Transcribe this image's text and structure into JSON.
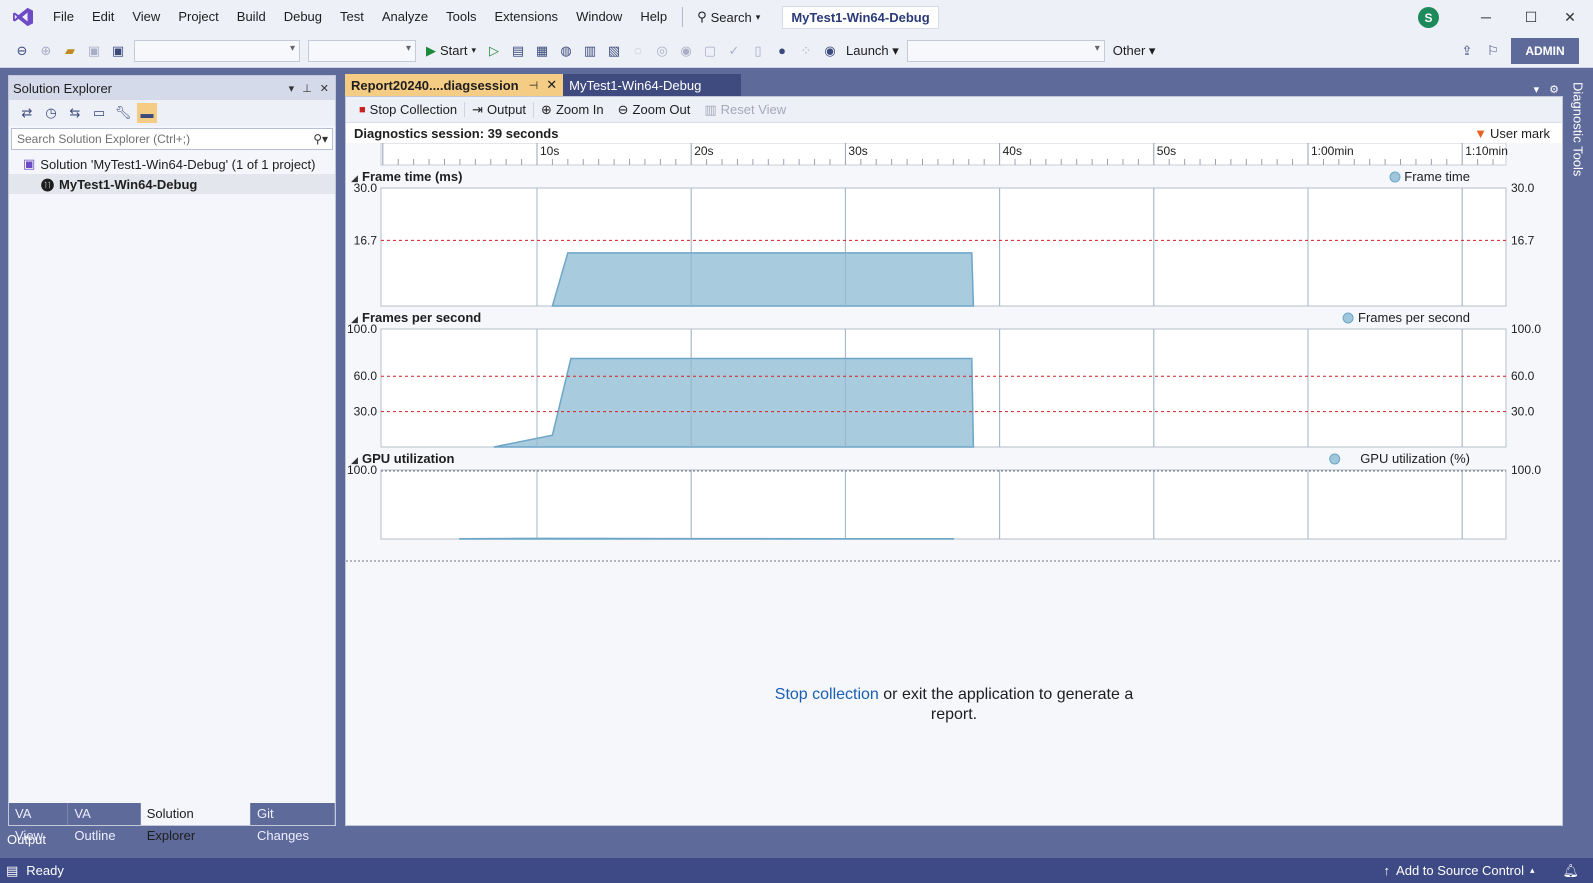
{
  "menu": {
    "items": [
      "File",
      "Edit",
      "View",
      "Project",
      "Build",
      "Debug",
      "Test",
      "Analyze",
      "Tools",
      "Extensions",
      "Window",
      "Help"
    ],
    "search_label": "Search",
    "project_title": "MyTest1-Win64-Debug",
    "avatar_letter": "S"
  },
  "toolbar": {
    "start_label": "Start",
    "launch_label": "Launch",
    "other_label": "Other",
    "admin_label": "ADMIN"
  },
  "solution_explorer": {
    "title": "Solution Explorer",
    "search_placeholder": "Search Solution Explorer (Ctrl+;)",
    "solution_label": "Solution 'MyTest1-Win64-Debug' (1 of 1 project)",
    "project_label": "MyTest1-Win64-Debug",
    "tabs": [
      "VA View",
      "VA Outline",
      "Solution Explorer",
      "Git Changes"
    ]
  },
  "doc_tabs": {
    "active": "Report20240....diagsession",
    "inactive": "MyTest1-Win64-Debug"
  },
  "diagnostics": {
    "toolbar": {
      "stop": "Stop Collection",
      "output": "Output",
      "zoom_in": "Zoom In",
      "zoom_out": "Zoom Out",
      "reset_view": "Reset View"
    },
    "session_text": "Diagnostics session: 39 seconds",
    "user_mark": "User mark",
    "report_link": "Stop collection",
    "report_text": " or exit the application to generate a report."
  },
  "side_tab": "Diagnostic Tools",
  "output_tab": "Output",
  "status": {
    "ready": "Ready",
    "source_control": "Add to Source Control"
  },
  "colors": {
    "accent": "#5e6a9a",
    "fill": "#9fc6da",
    "stroke": "#6ea6c8",
    "threshold": "#d02020",
    "tab_active": "#f5cc84"
  },
  "chart_data": [
    {
      "type": "area",
      "title": "Frame time (ms)",
      "legend": "Frame time",
      "ylim": [
        0,
        30
      ],
      "yticks": [
        30.0,
        16.7
      ],
      "ytick_labels": [
        "30.0",
        "16.7"
      ],
      "threshold": 16.7,
      "x": [
        11,
        12,
        20,
        30,
        38.2,
        38.3
      ],
      "values": [
        0,
        13.5,
        13.5,
        13.5,
        13.5,
        0
      ],
      "xaxis_ticks": [
        "10s",
        "20s",
        "30s",
        "40s",
        "50s",
        "1:00min",
        "1:10min"
      ]
    },
    {
      "type": "area",
      "title": "Frames per second",
      "legend": "Frames per second",
      "ylim": [
        0,
        100
      ],
      "yticks": [
        100.0,
        60.0,
        30.0
      ],
      "ytick_labels": [
        "100.0",
        "60.0",
        "30.0"
      ],
      "thresholds": [
        60,
        30
      ],
      "x": [
        7.2,
        11,
        12.2,
        20,
        30,
        38.2,
        38.3
      ],
      "values": [
        0,
        10,
        75,
        75,
        75,
        75,
        0
      ]
    },
    {
      "type": "area",
      "title": "GPU utilization",
      "legend": "GPU utilization (%)",
      "ylim": [
        0,
        100
      ],
      "yticks": [
        100.0
      ],
      "ytick_labels": [
        "100.0"
      ],
      "x": [
        5,
        10,
        20,
        30,
        37
      ],
      "values": [
        0.5,
        0.8,
        0.6,
        0.5,
        0.5
      ]
    }
  ]
}
